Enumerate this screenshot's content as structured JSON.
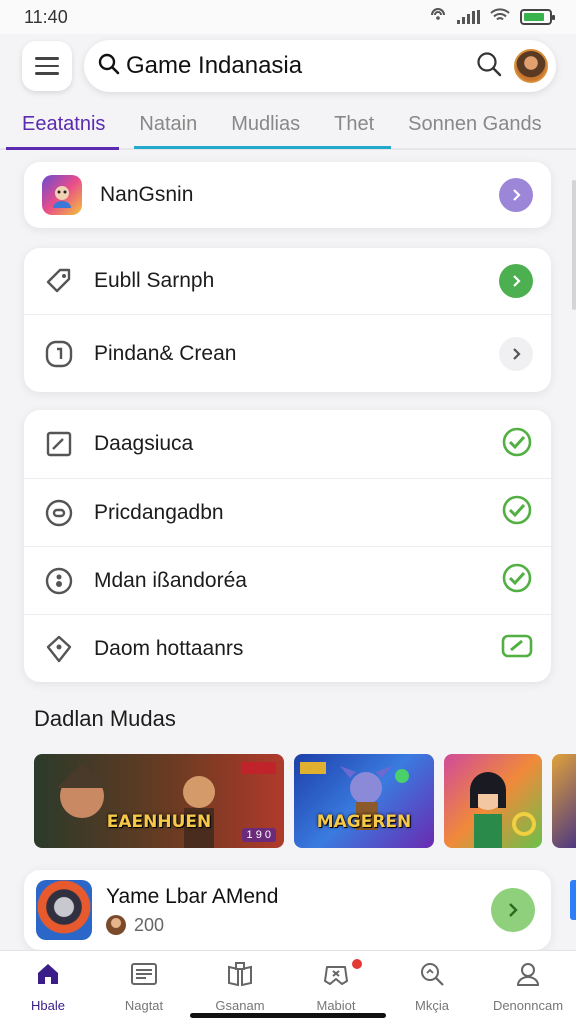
{
  "status_bar": {
    "time": "11:40"
  },
  "header": {
    "search_title": "Game Indanasia"
  },
  "tabs": [
    {
      "label": "Eeatatnis",
      "active": true
    },
    {
      "label": "Natain",
      "active": false
    },
    {
      "label": "Mudlias",
      "active": false
    },
    {
      "label": "Thet",
      "active": false
    },
    {
      "label": "Sonnen Gands",
      "active": false
    }
  ],
  "card_top": {
    "label": "NanGsnin",
    "action_color": "#9b86d8"
  },
  "card_two": [
    {
      "label": "Eubll Sarnph",
      "icon": "tag-icon",
      "action": "green-arrow"
    },
    {
      "label": "Pindan& Crean",
      "icon": "info-icon",
      "action": "grey-arrow"
    }
  ],
  "card_three": [
    {
      "label": "Daagsiuca",
      "icon": "edit-square-icon",
      "status": "check"
    },
    {
      "label": "Pricdangadbn",
      "icon": "circle-dot-icon",
      "status": "check"
    },
    {
      "label": "Mdan ißandoréa",
      "icon": "circle-eight-icon",
      "status": "check"
    },
    {
      "label": "Daom hottaanrs",
      "icon": "diamond-pin-icon",
      "status": "toggle"
    }
  ],
  "section": {
    "title": "Dadlan Mudas"
  },
  "media": [
    {
      "title": "EAENHUEN",
      "badge": "1 9 0"
    },
    {
      "title": "MAGEREN",
      "badge": ""
    },
    {
      "title": "",
      "badge": ""
    }
  ],
  "featured": {
    "title": "Yame Lbar AMend",
    "count": "200"
  },
  "bottom_nav": [
    {
      "label": "Hbale",
      "icon": "home-icon",
      "active": true
    },
    {
      "label": "Nagtat",
      "icon": "news-icon",
      "active": false
    },
    {
      "label": "Gsanam",
      "icon": "library-icon",
      "active": false
    },
    {
      "label": "Mabiot",
      "icon": "gamepad-icon",
      "active": false
    },
    {
      "label": "Mkçia",
      "icon": "search-icon",
      "active": false
    },
    {
      "label": "Denonncam",
      "icon": "profile-icon",
      "active": false
    }
  ],
  "colors": {
    "accent_purple": "#5b2bb0",
    "accent_teal": "#23a9c9",
    "check_green": "#52b043",
    "arrow_green": "#4caf50"
  }
}
